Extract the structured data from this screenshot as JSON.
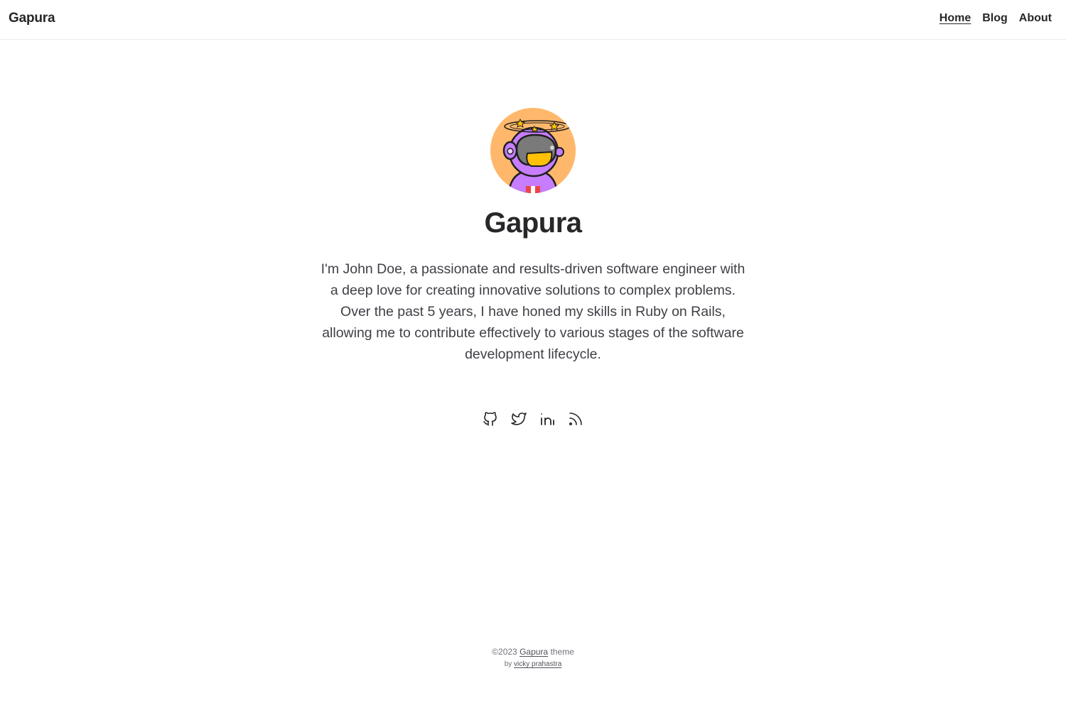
{
  "header": {
    "brand": "Gapura",
    "nav": [
      {
        "label": "Home",
        "active": true
      },
      {
        "label": "Blog",
        "active": false
      },
      {
        "label": "About",
        "active": false
      }
    ]
  },
  "hero": {
    "avatar_icon": "astronaut-avatar",
    "title": "Gapura",
    "bio": "I'm John Doe, a passionate and results-driven software engineer with a deep love for creating innovative solutions to complex problems. Over the past 5 years, I have honed my skills in Ruby on Rails, allowing me to contribute effectively to various stages of the software development lifecycle.",
    "socials": [
      {
        "icon": "github-icon"
      },
      {
        "icon": "twitter-icon"
      },
      {
        "icon": "linkedin-icon"
      },
      {
        "icon": "rss-icon"
      }
    ]
  },
  "footer": {
    "copyright": "©2023",
    "theme_link": "Gapura",
    "theme_suffix": "theme",
    "by_label": "by",
    "author_link": "vicky prahastra"
  },
  "colors": {
    "text": "#27272a",
    "muted": "#71717a",
    "avatar_bg": "#ffb86b",
    "suit": "#c77dff",
    "visor": "#ffc107"
  }
}
